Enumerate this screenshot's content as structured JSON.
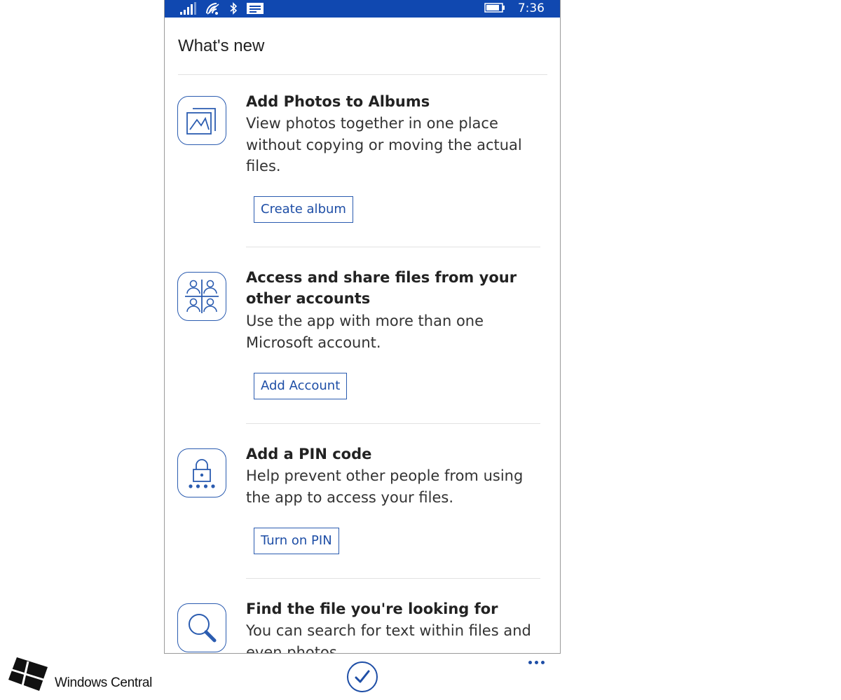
{
  "status_bar": {
    "time": "7:36",
    "icons": [
      "signal-icon",
      "wifi-icon",
      "bluetooth-icon",
      "message-icon",
      "battery-icon"
    ]
  },
  "page": {
    "title": "What's new"
  },
  "features": [
    {
      "title": "Add Photos to Albums",
      "description": "View photos together in one place without copying or moving the actual files.",
      "button": "Create album",
      "icon": "album-icon"
    },
    {
      "title": "Access and share files from your other accounts",
      "description": "Use the app with more than one Microsoft account.",
      "button": "Add Account",
      "icon": "accounts-icon"
    },
    {
      "title": "Add a PIN code",
      "description": "Help prevent other people from using the app to access your files.",
      "button": "Turn on PIN",
      "icon": "lock-icon"
    },
    {
      "title": "Find the file you're looking for",
      "description": "You can search for text within files and even photos.",
      "icon": "search-icon"
    }
  ],
  "app_bar": {
    "icons": [
      "checkmark-icon",
      "more-icon"
    ]
  },
  "watermark": {
    "text": "Windows Central",
    "icon": "windows-logo-icon"
  },
  "colors": {
    "accent": "#1e4ea6",
    "status_bar": "#1048b0",
    "divider": "#e2e2e2"
  }
}
